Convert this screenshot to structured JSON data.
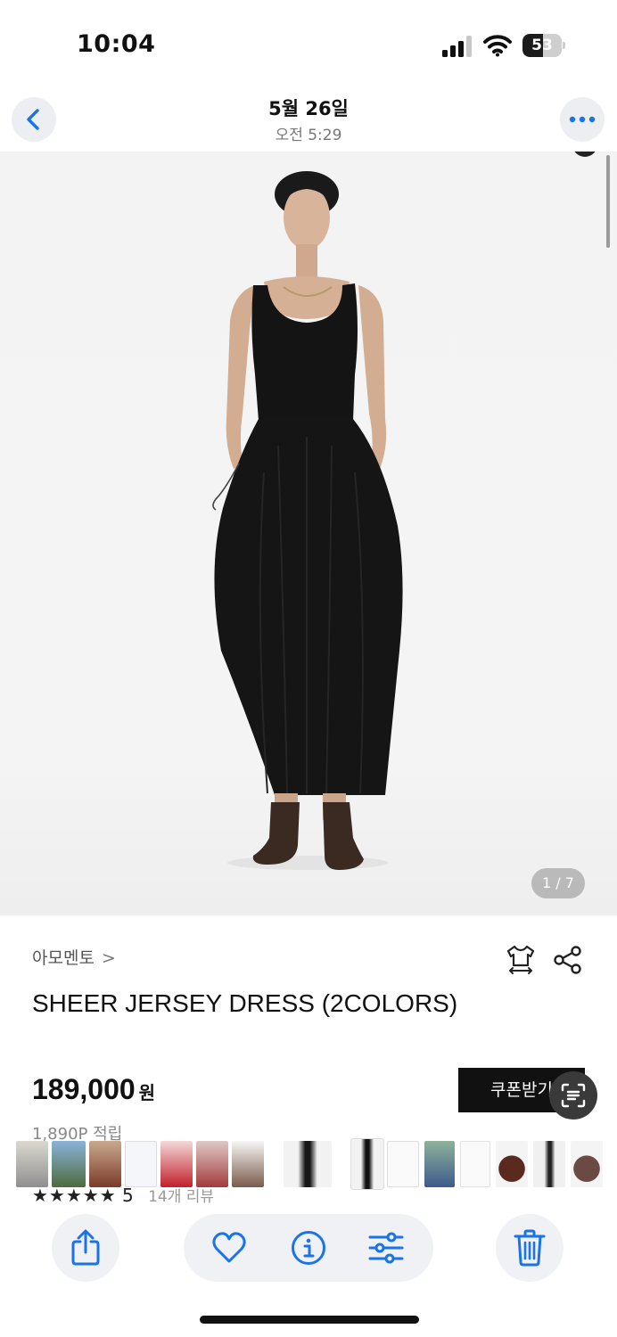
{
  "status_bar": {
    "time": "10:04",
    "battery_level": "53",
    "battery_fraction": 0.53
  },
  "photo_header": {
    "date": "5월 26일",
    "time": "오전 5:29",
    "back_icon": "chevron-left-icon",
    "more_icon": "ellipsis-icon"
  },
  "product": {
    "image_counter": "1 / 7",
    "brand": "아모멘토",
    "brand_chevron": ">",
    "title": "SHEER JERSEY DRESS (2COLORS)",
    "price": "189,000",
    "price_unit": "원",
    "coupon_label": "쿠폰받기",
    "points": "1,890P 적립",
    "rating_stars": "★★★★★",
    "rating_value": "5",
    "review_count": "14개 리뷰",
    "icons": [
      "size-guide-shirt-icon",
      "share-icon"
    ]
  },
  "thumbnail_strip": {
    "count": 17,
    "current_index": 8
  },
  "toolbar": {
    "items": [
      "share-icon",
      "heart-icon",
      "info-icon",
      "adjust-icon",
      "trash-icon"
    ]
  },
  "colors": {
    "accent": "#1a73e8",
    "dress": "#111111",
    "coupon_bg": "#111111"
  }
}
